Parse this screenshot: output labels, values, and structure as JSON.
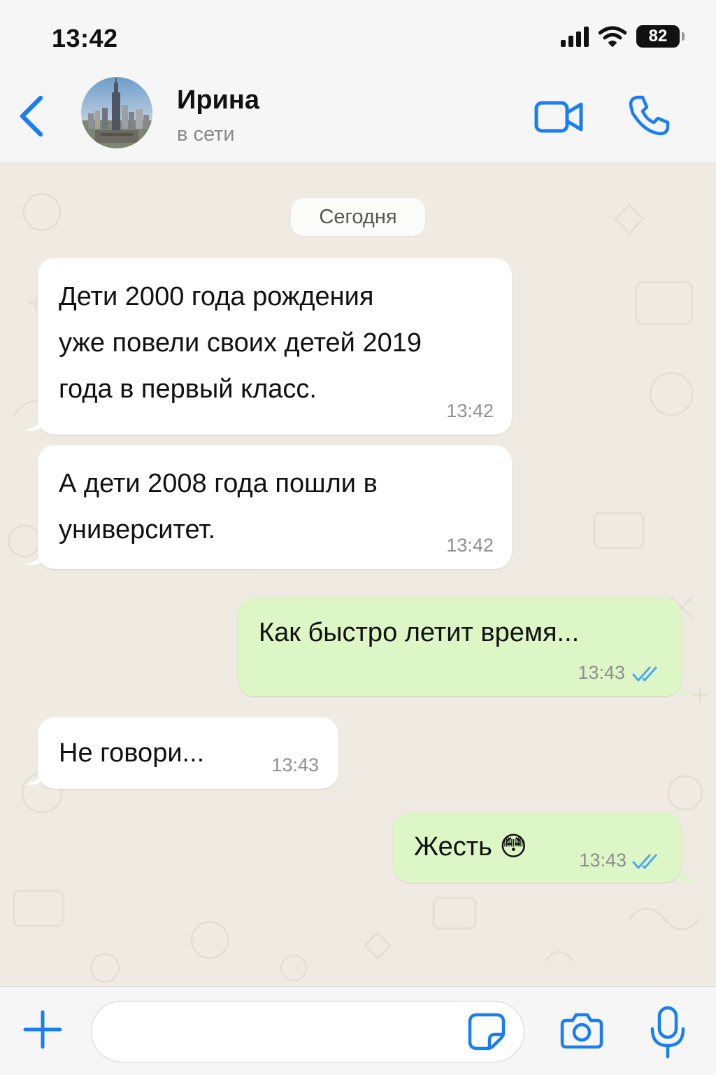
{
  "status_bar": {
    "time": "13:42",
    "battery": "82"
  },
  "header": {
    "contact_name": "Ирина",
    "contact_status": "в сети",
    "icons": [
      "chevron-left-icon",
      "video-call-icon",
      "phone-icon"
    ]
  },
  "chat": {
    "date_label": "Сегодня",
    "messages": [
      {
        "direction": "incoming",
        "text": "Дети 2000 года рождения\nуже повели своих детей 2019\nгода в первый класс.",
        "time": "13:42"
      },
      {
        "direction": "incoming",
        "text": "А дети 2008 года пошли в\nуниверситет.",
        "time": "13:42"
      },
      {
        "direction": "outgoing",
        "text": "Как быстро летит время...",
        "time": "13:43",
        "read": true
      },
      {
        "direction": "incoming",
        "text": "Не говори...",
        "time": "13:43"
      },
      {
        "direction": "outgoing",
        "text": "Жесть",
        "emoji": "😳",
        "time": "13:43",
        "read": true
      }
    ]
  },
  "input_bar": {
    "placeholder": "",
    "icons": [
      "plus-icon",
      "sticker-icon",
      "camera-icon",
      "microphone-icon"
    ]
  },
  "colors": {
    "accent": "#1a7ef3",
    "outgoing_bubble": "#dcf7c5",
    "incoming_bubble": "#ffffff",
    "read_ticks": "#53a6ea",
    "chat_background": "#efeae2"
  }
}
